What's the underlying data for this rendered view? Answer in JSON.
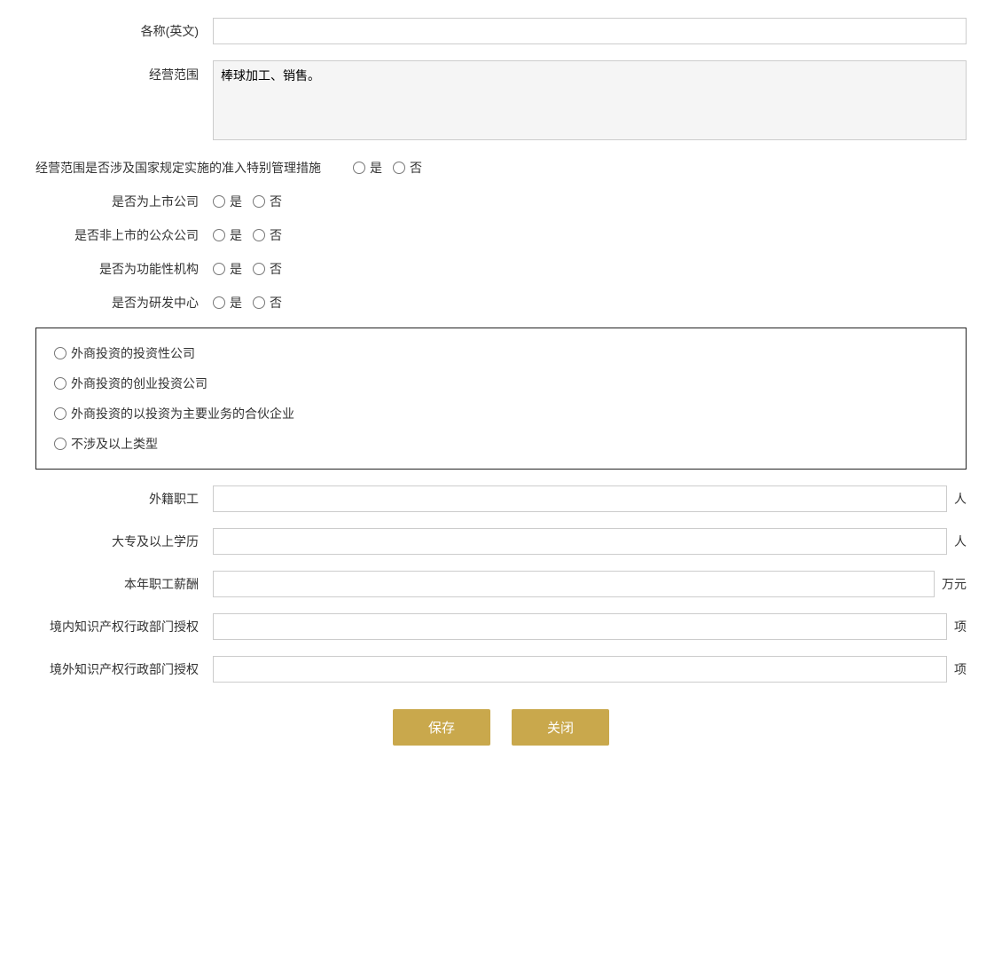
{
  "fields": {
    "name_en": {
      "label": "各称(英文)",
      "value": "",
      "placeholder": ""
    },
    "business_scope": {
      "label": "经营范围",
      "value": "棒球加工、销售。"
    },
    "special_management": {
      "label": "经营范围是否涉及国家规定实施的准入特别管理措施",
      "yes": "是",
      "no": "否"
    },
    "listed_company": {
      "label": "是否为上市公司",
      "yes": "是",
      "no": "否"
    },
    "unlisted_public": {
      "label": "是否非上市的公众公司",
      "yes": "是",
      "no": "否"
    },
    "functional_org": {
      "label": "是否为功能性机构",
      "yes": "是",
      "no": "否"
    },
    "rd_center": {
      "label": "是否为研发中心",
      "yes": "是",
      "no": "否"
    }
  },
  "investment_types": [
    "外商投资的投资性公司",
    "外商投资的创业投资公司",
    "外商投资的以投资为主要业务的合伙企业",
    "不涉及以上类型"
  ],
  "extra_fields": {
    "foreign_employees": {
      "label": "外籍职工",
      "unit": "人",
      "value": ""
    },
    "college_education": {
      "label": "大专及以上学历",
      "unit": "人",
      "value": ""
    },
    "annual_salary": {
      "label": "本年职工薪酬",
      "unit": "万元",
      "value": ""
    },
    "domestic_ip": {
      "label": "境内知识产权行政部门授权",
      "unit": "项",
      "value": ""
    },
    "overseas_ip": {
      "label": "境外知识产权行政部门授权",
      "unit": "项",
      "value": ""
    }
  },
  "buttons": {
    "save": "保存",
    "close": "关闭"
  }
}
